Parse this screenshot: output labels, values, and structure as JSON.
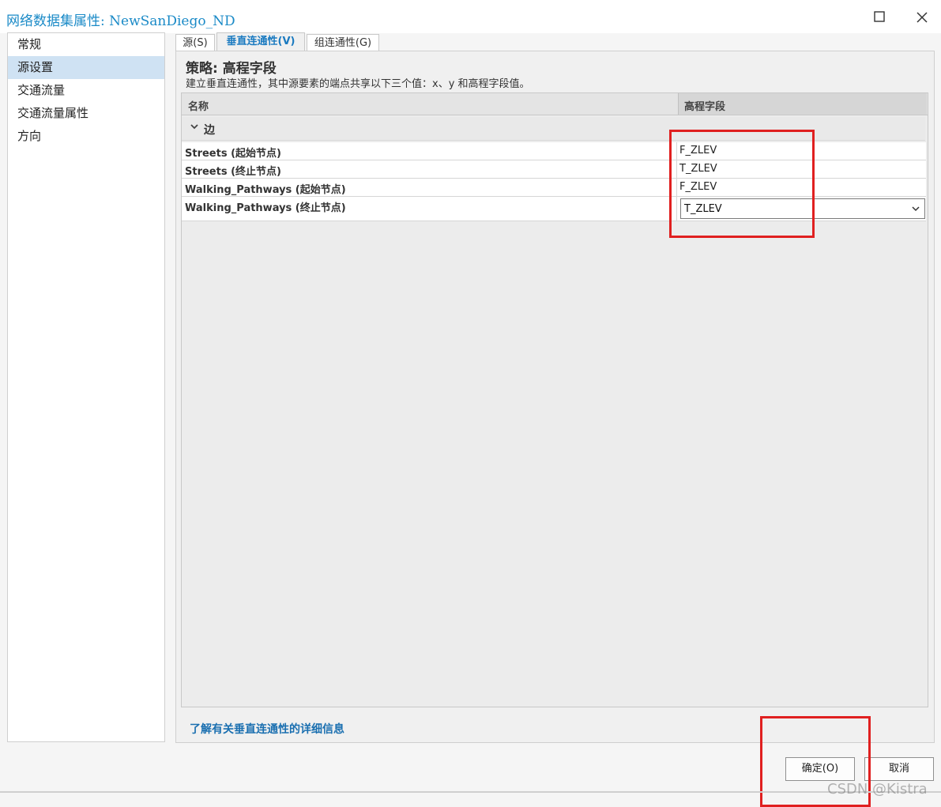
{
  "window": {
    "title": "网络数据集属性: NewSanDiego_ND"
  },
  "sidebar": {
    "items": [
      {
        "label": "常规"
      },
      {
        "label": "源设置"
      },
      {
        "label": "交通流量"
      },
      {
        "label": "交通流量属性"
      },
      {
        "label": "方向"
      }
    ],
    "selected_index": 1
  },
  "tabs": [
    {
      "label": "源(S)"
    },
    {
      "label": "垂直连通性(V)"
    },
    {
      "label": "组连通性(G)"
    }
  ],
  "active_tab": 1,
  "panel": {
    "strategy_title": "策略: 高程字段",
    "strategy_desc": "建立垂直连通性，其中源要素的端点共享以下三个值：x、y 和高程字段值。",
    "grid": {
      "columns": {
        "name": "名称",
        "elevation": "高程字段"
      },
      "group_label": "边",
      "rows": [
        {
          "name": "Streets (起始节点)",
          "elevation": "F_ZLEV"
        },
        {
          "name": "Streets (终止节点)",
          "elevation": "T_ZLEV"
        },
        {
          "name": "Walking_Pathways (起始节点)",
          "elevation": "F_ZLEV"
        },
        {
          "name": "Walking_Pathways (终止节点)",
          "elevation": "T_ZLEV"
        }
      ]
    },
    "learn_more": "了解有关垂直连通性的详细信息"
  },
  "buttons": {
    "ok": "确定(O)",
    "cancel": "取消"
  },
  "watermark": "CSDN @Kistra",
  "colors": {
    "accent": "#1a8ac7",
    "highlight_box": "#e02020",
    "selected_bg": "#cfe2f3"
  }
}
